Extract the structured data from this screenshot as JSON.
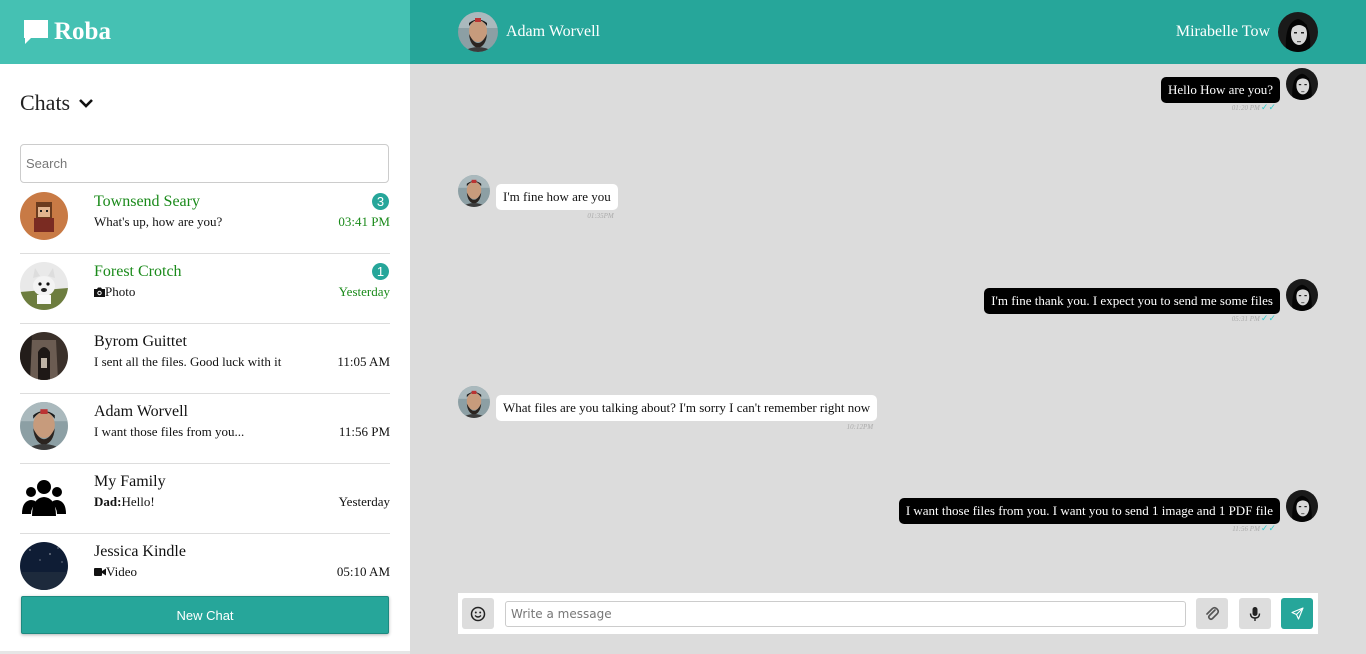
{
  "app": {
    "name": "Roba"
  },
  "header": {
    "peer_name": "Adam Worvell",
    "user_name": "Mirabelle Tow"
  },
  "sidebar": {
    "title": "Chats",
    "search_placeholder": "Search",
    "chats": [
      {
        "name": "Townsend Seary",
        "preview": "What's up, how are you?",
        "time": "03:41 PM",
        "badge": "3",
        "unread": true
      },
      {
        "name": "Forest Crotch",
        "preview_icon": "camera-icon",
        "preview": "Photo",
        "time": "Yesterday",
        "badge": "1",
        "unread": true
      },
      {
        "name": "Byrom Guittet",
        "preview": "I sent all the files. Good luck with it",
        "time": "11:05 AM"
      },
      {
        "name": "Adam Worvell",
        "preview": "I want those files from you...",
        "time": "11:56 PM"
      },
      {
        "name": "My Family",
        "preview_sender": "Dad:",
        "preview": "Hello!",
        "time": "Yesterday"
      },
      {
        "name": "Jessica Kindle",
        "preview_icon": "video-icon",
        "preview": "Video",
        "time": "05:10 AM"
      }
    ],
    "new_chat_label": "New Chat"
  },
  "messages": [
    {
      "direction": "out",
      "text": "Hello How are you?",
      "time": "01:20 PM"
    },
    {
      "direction": "in",
      "text": "I'm fine how are you",
      "time": "01:35PM"
    },
    {
      "direction": "out",
      "text": "I'm fine thank you. I expect you to send me some files",
      "time": "05:31 PM"
    },
    {
      "direction": "in",
      "text": "What files are you talking about? I'm sorry I can't remember right now",
      "time": "10:12PM"
    },
    {
      "direction": "out",
      "text": "I want those files from you. I want you to send 1 image and 1 PDF file",
      "time": "11:56 PM"
    }
  ],
  "composer": {
    "placeholder": "Write a message"
  },
  "colors": {
    "brand_light": "#45c1b3",
    "brand": "#26a69a",
    "unread_name": "#1a8a1a",
    "chat_bg": "#dcdcdc"
  }
}
